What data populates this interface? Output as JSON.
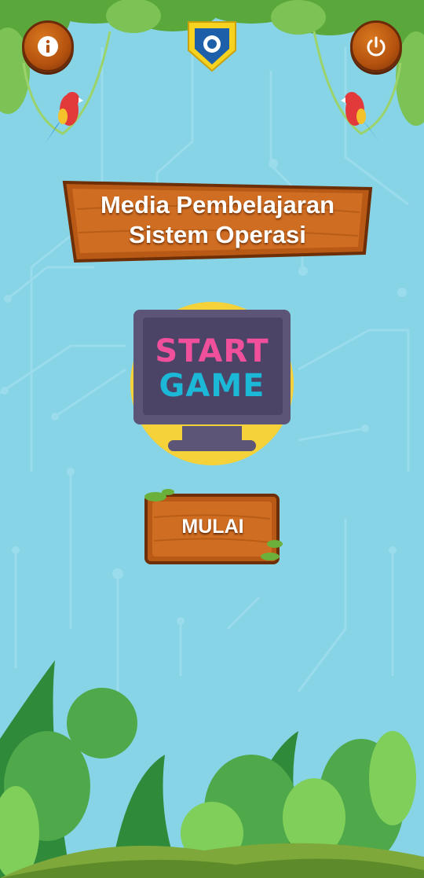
{
  "header": {
    "info_icon": "info-icon",
    "power_icon": "power-icon",
    "logo_name": "school-logo"
  },
  "title": {
    "line1": "Media Pembelajaran",
    "line2": "Sistem Operasi"
  },
  "hero": {
    "start_word": "START",
    "game_word": "GAME"
  },
  "mulai_button": {
    "label": "MULAI"
  },
  "colors": {
    "background": "#86d4e6",
    "wood": "#c2661c",
    "start_pink": "#f04f9c",
    "game_cyan": "#1cb8d8",
    "circle_yellow": "#f5d23a"
  }
}
